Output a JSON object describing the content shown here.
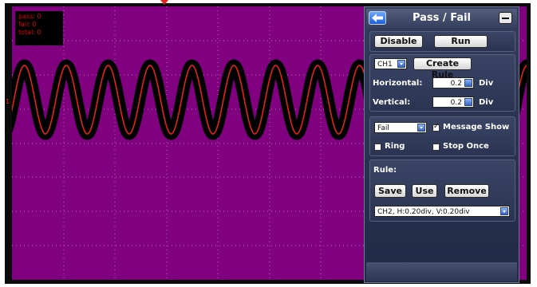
{
  "stats": {
    "pass": "pass: 0",
    "fail": "fail: 0",
    "total": "total: 0"
  },
  "channel_marker": "1",
  "panel": {
    "title": "Pass / Fail",
    "disable_label": "Disable",
    "run_label": "Run",
    "source_value": "CH1",
    "create_rule_label": "Create Rule",
    "horizontal_label": "Horizontal:",
    "horizontal_value": "0.2",
    "horizontal_unit": "Div",
    "vertical_label": "Vertical:",
    "vertical_value": "0.2",
    "vertical_unit": "Div",
    "output_value": "Fail",
    "message_show_label": "Message Show",
    "ring_label": "Ring",
    "stop_once_label": "Stop Once",
    "rule_label": "Rule:",
    "save_label": "Save",
    "use_label": "Use",
    "remove_label": "Remove",
    "rule_value": "CH2, H:0.20div, V:0.20div"
  },
  "colors": {
    "screen": "#800080",
    "trace": "#e2231a",
    "mask": "#000000",
    "panel": "#2a3452"
  }
}
